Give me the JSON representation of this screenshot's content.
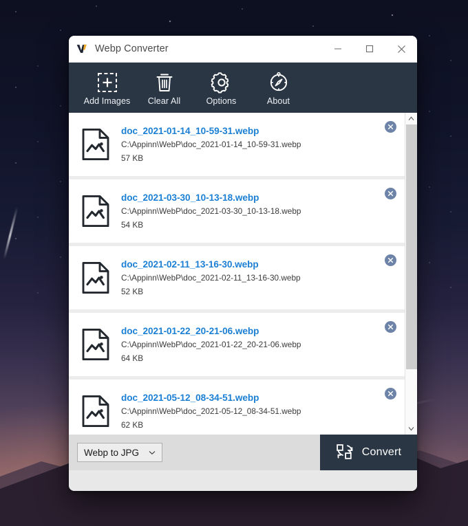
{
  "window": {
    "title": "Webp Converter",
    "logo_icon": "webp-converter-logo",
    "controls": {
      "minimize": "minimize-icon",
      "maximize": "maximize-icon",
      "close": "close-icon"
    }
  },
  "toolbar": {
    "accent_bg": "#2b3644",
    "buttons": [
      {
        "label": "Add Images",
        "icon": "add-images-icon"
      },
      {
        "label": "Clear All",
        "icon": "trash-icon"
      },
      {
        "label": "Options",
        "icon": "gear-icon"
      },
      {
        "label": "About",
        "icon": "compass-icon"
      }
    ]
  },
  "file_list": {
    "link_color": "#1b7fd4",
    "remove_icon": "remove-circle-icon",
    "file_icon": "image-document-icon",
    "items": [
      {
        "name": "doc_2021-01-14_10-59-31.webp",
        "path": "C:\\Appinn\\WebP\\doc_2021-01-14_10-59-31.webp",
        "size": "57 KB"
      },
      {
        "name": "doc_2021-03-30_10-13-18.webp",
        "path": "C:\\Appinn\\WebP\\doc_2021-03-30_10-13-18.webp",
        "size": "54 KB"
      },
      {
        "name": "doc_2021-02-11_13-16-30.webp",
        "path": "C:\\Appinn\\WebP\\doc_2021-02-11_13-16-30.webp",
        "size": "52 KB"
      },
      {
        "name": "doc_2021-01-22_20-21-06.webp",
        "path": "C:\\Appinn\\WebP\\doc_2021-01-22_20-21-06.webp",
        "size": "64 KB"
      },
      {
        "name": "doc_2021-05-12_08-34-51.webp",
        "path": "C:\\Appinn\\WebP\\doc_2021-05-12_08-34-51.webp",
        "size": "62 KB"
      }
    ]
  },
  "scrollbar": {
    "up_icon": "chevron-up-icon",
    "down_icon": "chevron-down-icon"
  },
  "bottom_bar": {
    "format_select": {
      "value": "Webp to JPG",
      "chevron_icon": "chevron-down-icon"
    },
    "convert": {
      "label": "Convert",
      "icon": "convert-icon"
    }
  }
}
